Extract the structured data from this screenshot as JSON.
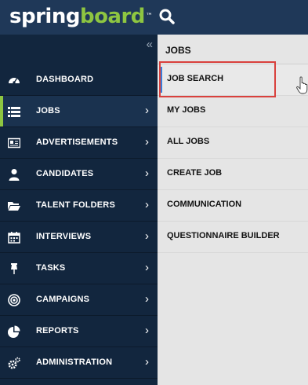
{
  "topbar": {
    "logo_part1": "spring",
    "logo_part2": "board",
    "logo_tm": "™",
    "search_icon": "search-icon"
  },
  "sidebar": {
    "collapse_label": "«",
    "items": [
      {
        "label": "DASHBOARD",
        "icon": "dashboard-icon",
        "has_chevron": false
      },
      {
        "label": "JOBS",
        "icon": "list-icon",
        "has_chevron": true,
        "active": true
      },
      {
        "label": "ADVERTISEMENTS",
        "icon": "newspaper-icon",
        "has_chevron": true
      },
      {
        "label": "CANDIDATES",
        "icon": "user-icon",
        "has_chevron": true
      },
      {
        "label": "TALENT FOLDERS",
        "icon": "folder-icon",
        "has_chevron": true
      },
      {
        "label": "INTERVIEWS",
        "icon": "calendar-icon",
        "has_chevron": true
      },
      {
        "label": "TASKS",
        "icon": "pin-icon",
        "has_chevron": true
      },
      {
        "label": "CAMPAIGNS",
        "icon": "target-icon",
        "has_chevron": true
      },
      {
        "label": "REPORTS",
        "icon": "pie-chart-icon",
        "has_chevron": true
      },
      {
        "label": "ADMINISTRATION",
        "icon": "cogs-icon",
        "has_chevron": true
      }
    ],
    "chevron": "›"
  },
  "submenu": {
    "title": "JOBS",
    "items": [
      {
        "label": "JOB SEARCH",
        "selected": true
      },
      {
        "label": "MY JOBS"
      },
      {
        "label": "ALL JOBS"
      },
      {
        "label": "CREATE JOB"
      },
      {
        "label": "COMMUNICATION"
      },
      {
        "label": "QUESTIONNAIRE BUILDER"
      }
    ]
  },
  "colors": {
    "topbar": "#1f3858",
    "sidebar": "#12263e",
    "accent_green": "#8ec641",
    "submenu_bg": "#e5e5e5",
    "highlight": "#d9413d",
    "selected_accent": "#3b7dd8"
  }
}
